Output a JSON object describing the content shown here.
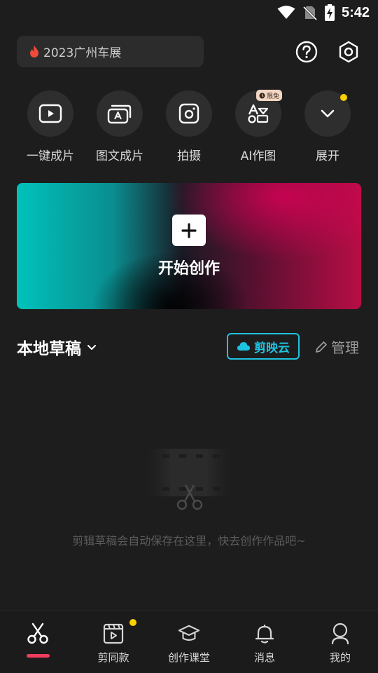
{
  "status_bar": {
    "time": "5:42",
    "icons": [
      "wifi-icon",
      "no-sim-icon",
      "battery-charging-icon"
    ]
  },
  "header": {
    "search": {
      "icon": "fire-icon",
      "text": "2023广州车展"
    },
    "help_icon": "help-icon",
    "settings_icon": "settings-icon"
  },
  "quick_actions": [
    {
      "label": "一键成片",
      "icon": "play-screen-icon"
    },
    {
      "label": "图文成片",
      "icon": "text-to-video-icon"
    },
    {
      "label": "拍摄",
      "icon": "camera-icon"
    },
    {
      "label": "AI作图",
      "icon": "ai-draw-icon",
      "tag": "限免"
    },
    {
      "label": "展开",
      "icon": "chevron-down-icon",
      "has_dot": true
    }
  ],
  "create_banner": {
    "label": "开始创作",
    "icon": "plus-icon"
  },
  "drafts": {
    "title": "本地草稿",
    "cloud_button": "剪映云",
    "manage": "管理",
    "empty_message": "剪辑草稿会自动保存在这里，快去创作作品吧~"
  },
  "tabbar": {
    "active": 0,
    "tabs": [
      {
        "label": "",
        "icon": "scissors-icon"
      },
      {
        "label": "剪同款",
        "icon": "template-icon",
        "has_dot": true
      },
      {
        "label": "创作课堂",
        "icon": "graduation-cap-icon"
      },
      {
        "label": "消息",
        "icon": "bell-icon"
      },
      {
        "label": "我的",
        "icon": "profile-icon"
      }
    ]
  },
  "colors": {
    "background": "#1d1d1d",
    "accent_cyan": "#1fc3e2",
    "tab_indicator": "#ee3d5d",
    "notification_dot": "#fdd000"
  }
}
